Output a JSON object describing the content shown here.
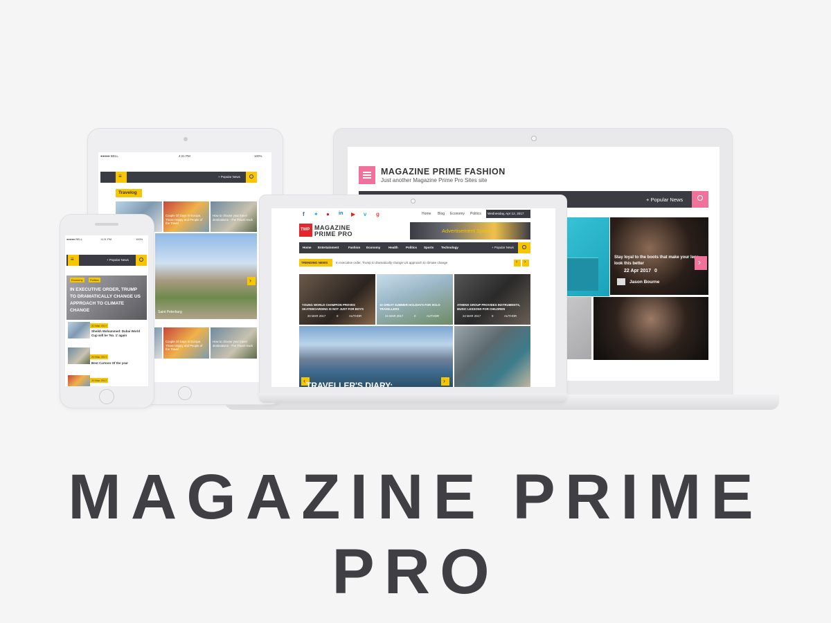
{
  "title": "MAGAZINE PRIME PRO",
  "title_lines": [
    "MAGAZINE PRIME",
    "PRO"
  ],
  "colors": {
    "accent_yellow": "#f7c600",
    "accent_pink": "#f0729a",
    "dark_bar": "#3b3b44",
    "title_text": "#3f3f44"
  },
  "desktop": {
    "site_title": "MAGAZINE PRIME FASHION",
    "tagline": "Just another Magazine Prime Pro Sites site",
    "popular": "+ Popular News",
    "feature_caption": "Stay loyal to the boots that make your legs look this better",
    "feature_date": "22 Apr 2017",
    "feature_comments": "0",
    "feature_author": "Jason Bourne"
  },
  "laptop": {
    "top_links": [
      "Home",
      "Blog",
      "Economy",
      "Politics"
    ],
    "date": "Wednesday, Apr 12, 2017",
    "logo_badge": "TWP",
    "logo_line1": "MAGAZINE",
    "logo_line2": "PRIME PRO",
    "ad": "Advertisement Space",
    "nav": [
      "Home",
      "Entertainment",
      "Fashion",
      "Economy",
      "Health",
      "Politics",
      "Sports",
      "Technology"
    ],
    "popular": "+ Popular News",
    "trending_label": "TRENDING NEWS",
    "trending_text": "In executive order, Trump to dramatically change US approach to climate change",
    "cards": [
      {
        "title": "YOUNG WORLD CHAMPION PROVES SKATEBOARDING IS NOT JUST FOR BOYS",
        "date": "20 MAR 2017",
        "comments": "0",
        "author": "AUTHOR"
      },
      {
        "title": "10 GREAT SUMMER HOLIDAYS FOR SOLO TRAVELLERS",
        "date": "24 MAR 2017",
        "comments": "0",
        "author": "AUTHOR"
      },
      {
        "title": "ATHENS GROUP PROVIDES INSTRUMENTS, MUSIC LESSONS FOR CHILDREN",
        "date": "24 MAR 2017",
        "comments": "0",
        "author": "AUTHOR"
      }
    ],
    "big_caption": "TRAVELLER'S DIARY:"
  },
  "tablet": {
    "carrier": "●●●●● BELL",
    "time": "4:21 PM",
    "battery": "100%",
    "popular": "+ Popular News",
    "section": "Travelog",
    "item1": "Couple Of Days In Europe, Those Happy and People of the Travel",
    "item2": "How to choose your travel destinations - The Travel Hack",
    "city_caption": "Saint Peterburg",
    "item3": "Couple Of Days In Europe, Those Happy and People of the Travel",
    "item4": "How to choose your travel destinations - The Travel Hack"
  },
  "phone": {
    "carrier": "●●●●● BELL",
    "time": "4:21 PM",
    "battery": "100%",
    "popular": "+ Popular News",
    "tags": [
      "Economy",
      "Politics"
    ],
    "headline": "IN EXECUTIVE ORDER, TRUMP TO DRAMATICALLY CHANGE US APPROACH TO CLIMATE CHANGE",
    "items": [
      {
        "date": "20 Mar 2017",
        "title": "Sheikh Mohammed: Dubai World Cup will be 'No. 1' again"
      },
      {
        "date": "20 Mar 2017",
        "title": "Best Cartoon Of the year"
      },
      {
        "date": "20 Mar 2017",
        "title": ""
      }
    ]
  }
}
